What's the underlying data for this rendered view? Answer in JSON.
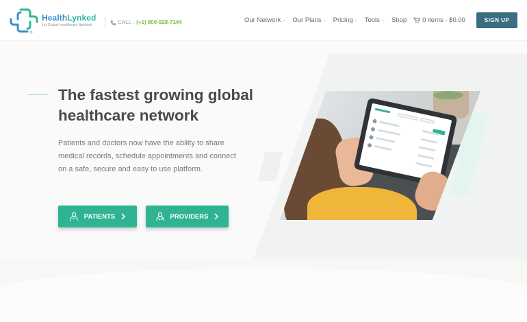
{
  "brand": {
    "name_part1": "Health",
    "name_part2": "Lynked",
    "tagline": "1st Global Healthcare Network",
    "registered": "®"
  },
  "header": {
    "call_label": "CALL :",
    "phone": "(+1) 800-928-7144",
    "nav": [
      {
        "label": "Our Network",
        "has_dropdown": true
      },
      {
        "label": "Our Plans",
        "has_dropdown": true
      },
      {
        "label": "Pricing",
        "has_dropdown": true
      },
      {
        "label": "Tools",
        "has_dropdown": true
      },
      {
        "label": "Shop",
        "has_dropdown": false
      }
    ],
    "cart_label": "0 items - $0.00",
    "signup_label": "SIGN UP"
  },
  "hero": {
    "headline": "The fastest growing global healthcare network",
    "description": "Patients and doctors now have the ability to share medical records, schedule appointments and connect on a safe, secure and easy to use platform.",
    "buttons": [
      {
        "label": "PATIENTS",
        "icon": "patient-icon"
      },
      {
        "label": "PROVIDERS",
        "icon": "provider-icon"
      }
    ]
  },
  "colors": {
    "accent_green": "#2fb493",
    "phone_green": "#7ac043",
    "signup_bg": "#3a6f82",
    "text_dark": "#4a4a4a"
  }
}
